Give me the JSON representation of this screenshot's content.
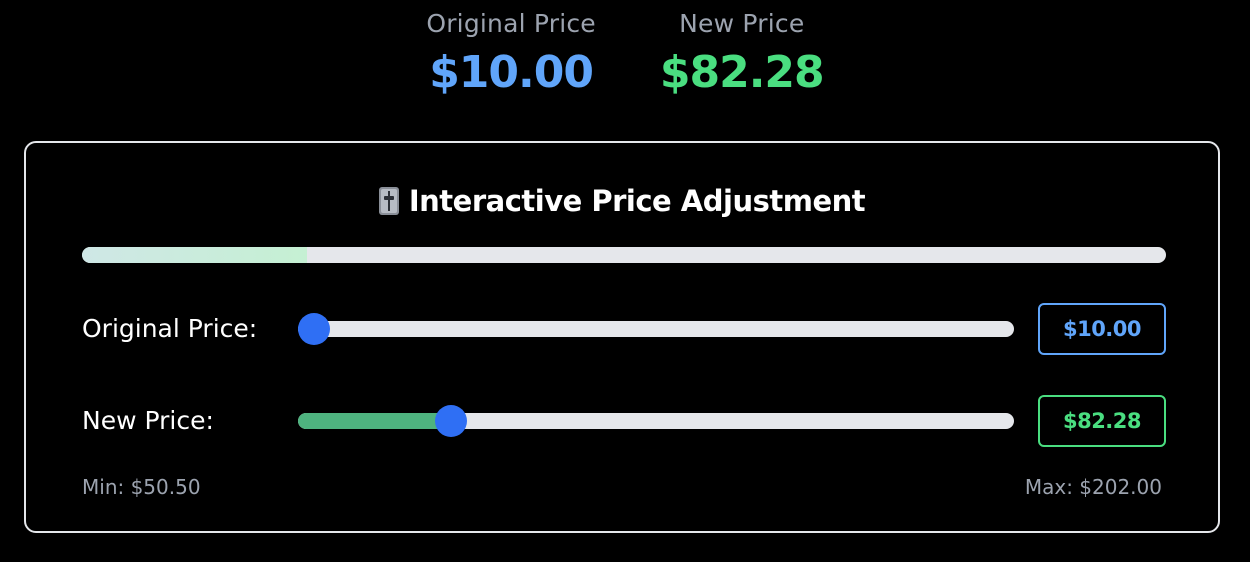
{
  "summary": {
    "original_label": "Original Price",
    "original_value": "$10.00",
    "new_label": "New Price",
    "new_value": "$82.28"
  },
  "panel": {
    "emoji_icon": "slider-control-icon",
    "title": "Interactive Price Adjustment",
    "progress_fraction": 0.208,
    "original": {
      "label": "Original Price:",
      "slider_fraction": 0.0,
      "input_value": "$10.00"
    },
    "new": {
      "label": "New Price:",
      "slider_fraction": 0.2,
      "input_value": "$82.28"
    },
    "min_label": "Min: $50.50",
    "max_label": "Max: $202.00"
  },
  "colors": {
    "original_accent": "#60a5fa",
    "new_accent": "#4ade80",
    "thumb": "#2f6ff4",
    "slider_fill": "#4eb37f"
  }
}
